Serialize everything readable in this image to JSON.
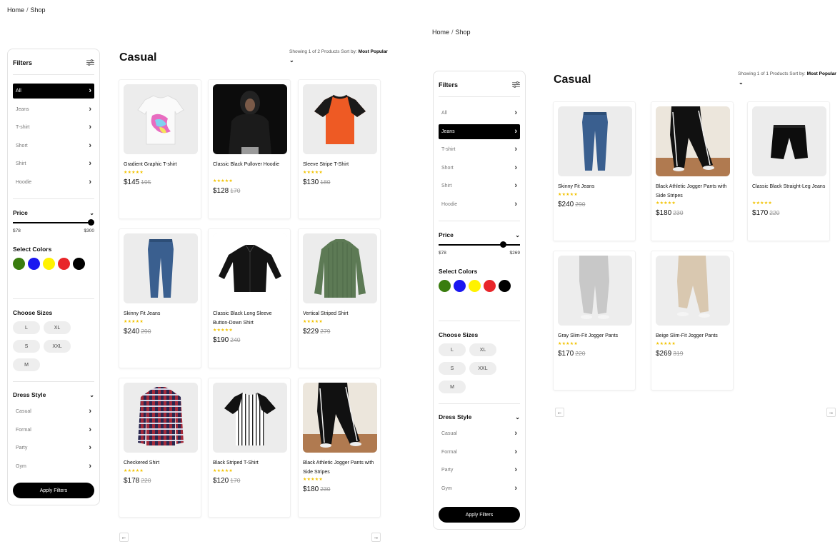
{
  "left": {
    "breadcrumb": [
      "Home",
      "Shop"
    ],
    "filters_title": "Filters",
    "categories": [
      "All",
      "Jeans",
      "T-shirt",
      "Short",
      "Shirt",
      "Hoodie"
    ],
    "active_category": 0,
    "price": {
      "title": "Price",
      "min": "$78",
      "max": "$300",
      "level": 1.0
    },
    "colors_title": "Select Colors",
    "colors": [
      "#3a7d0f",
      "#1a17f0",
      "#fff200",
      "#e8262a",
      "#000000"
    ],
    "sizes_title": "Choose Sizes",
    "sizes": [
      "L",
      "XL",
      "S",
      "XXL",
      "M"
    ],
    "dress_title": "Dress Style",
    "dress_styles": [
      "Casual",
      "Formal",
      "Party",
      "Gym"
    ],
    "apply": "Apply Filters",
    "heading": "Casual",
    "showing": "Showing 1 of 2 Products Sort by:",
    "sort": "Most Popular",
    "products": [
      {
        "name": "Gradient Graphic T-shirt",
        "stars": "★★★★★",
        "price": "$145",
        "old": "195",
        "icon": "white-graphic-tshirt"
      },
      {
        "name": "Classic Black Pullover Hoodie",
        "stars": "★★★★★",
        "price": "$128",
        "old": "170",
        "icon": "black-hoodie"
      },
      {
        "name": "Sleeve Stripe T-Shirt",
        "stars": "★★★★★",
        "price": "$130",
        "old": "180",
        "icon": "orange-black-tshirt"
      },
      {
        "name": "Skinny Fit Jeans",
        "stars": "★★★★★",
        "price": "$240",
        "old": "290",
        "icon": "blue-jeans"
      },
      {
        "name": "Classic Black Long Sleeve Button-Down Shirt",
        "stars": "★★★★★",
        "price": "$190",
        "old": "240",
        "icon": "black-shirt"
      },
      {
        "name": "Vertical Striped Shirt",
        "stars": "★★★★★",
        "price": "$229",
        "old": "279",
        "icon": "green-striped-shirt"
      },
      {
        "name": "Checkered Shirt",
        "stars": "★★★★★",
        "price": "$178",
        "old": "220",
        "icon": "checkered-shirt"
      },
      {
        "name": "Black Striped T-Shirt",
        "stars": "★★★★★",
        "price": "$120",
        "old": "170",
        "icon": "striped-tshirt"
      },
      {
        "name": "Black Athletic Jogger Pants with Side Stripes",
        "stars": "★★★★★",
        "price": "$180",
        "old": "230",
        "icon": "black-joggers"
      }
    ],
    "prev": "←",
    "next": "→"
  },
  "right": {
    "breadcrumb": [
      "Home",
      "Shop"
    ],
    "filters_title": "Filters",
    "categories": [
      "All",
      "Jeans",
      "T-shirt",
      "Short",
      "Shirt",
      "Hoodie"
    ],
    "active_category": 1,
    "price": {
      "title": "Price",
      "min": "$78",
      "max": "$269",
      "level": 0.83
    },
    "colors_title": "Select Colors",
    "colors": [
      "#3a7d0f",
      "#1a17f0",
      "#fff200",
      "#e8262a",
      "#000000"
    ],
    "sizes_title": "Choose Sizes",
    "sizes": [
      "L",
      "XL",
      "S",
      "XXL",
      "M"
    ],
    "dress_title": "Dress Style",
    "dress_styles": [
      "Casual",
      "Formal",
      "Party",
      "Gym"
    ],
    "apply": "Apply Filters",
    "heading": "Casual",
    "showing": "Showing 1 of 1 Products Sort by:",
    "sort": "Most Popular",
    "products": [
      {
        "name": "Skinny Fit Jeans",
        "stars": "★★★★★",
        "price": "$240",
        "old": "290",
        "icon": "blue-jeans"
      },
      {
        "name": "Black Athletic Jogger Pants with Side Stripes",
        "stars": "★★★★★",
        "price": "$180",
        "old": "230",
        "icon": "black-joggers"
      },
      {
        "name": "Classic Black Straight-Leg Jeans",
        "stars": "★★★★★",
        "price": "$170",
        "old": "220",
        "icon": "black-shorts"
      },
      {
        "name": "Gray Slim-Fit Jogger Pants",
        "stars": "★★★★★",
        "price": "$170",
        "old": "220",
        "icon": "gray-joggers"
      },
      {
        "name": "Beige Slim-Fit Jogger Pants",
        "stars": "★★★★★",
        "price": "$269",
        "old": "319",
        "icon": "beige-joggers"
      }
    ],
    "prev": "←",
    "next": "→"
  }
}
